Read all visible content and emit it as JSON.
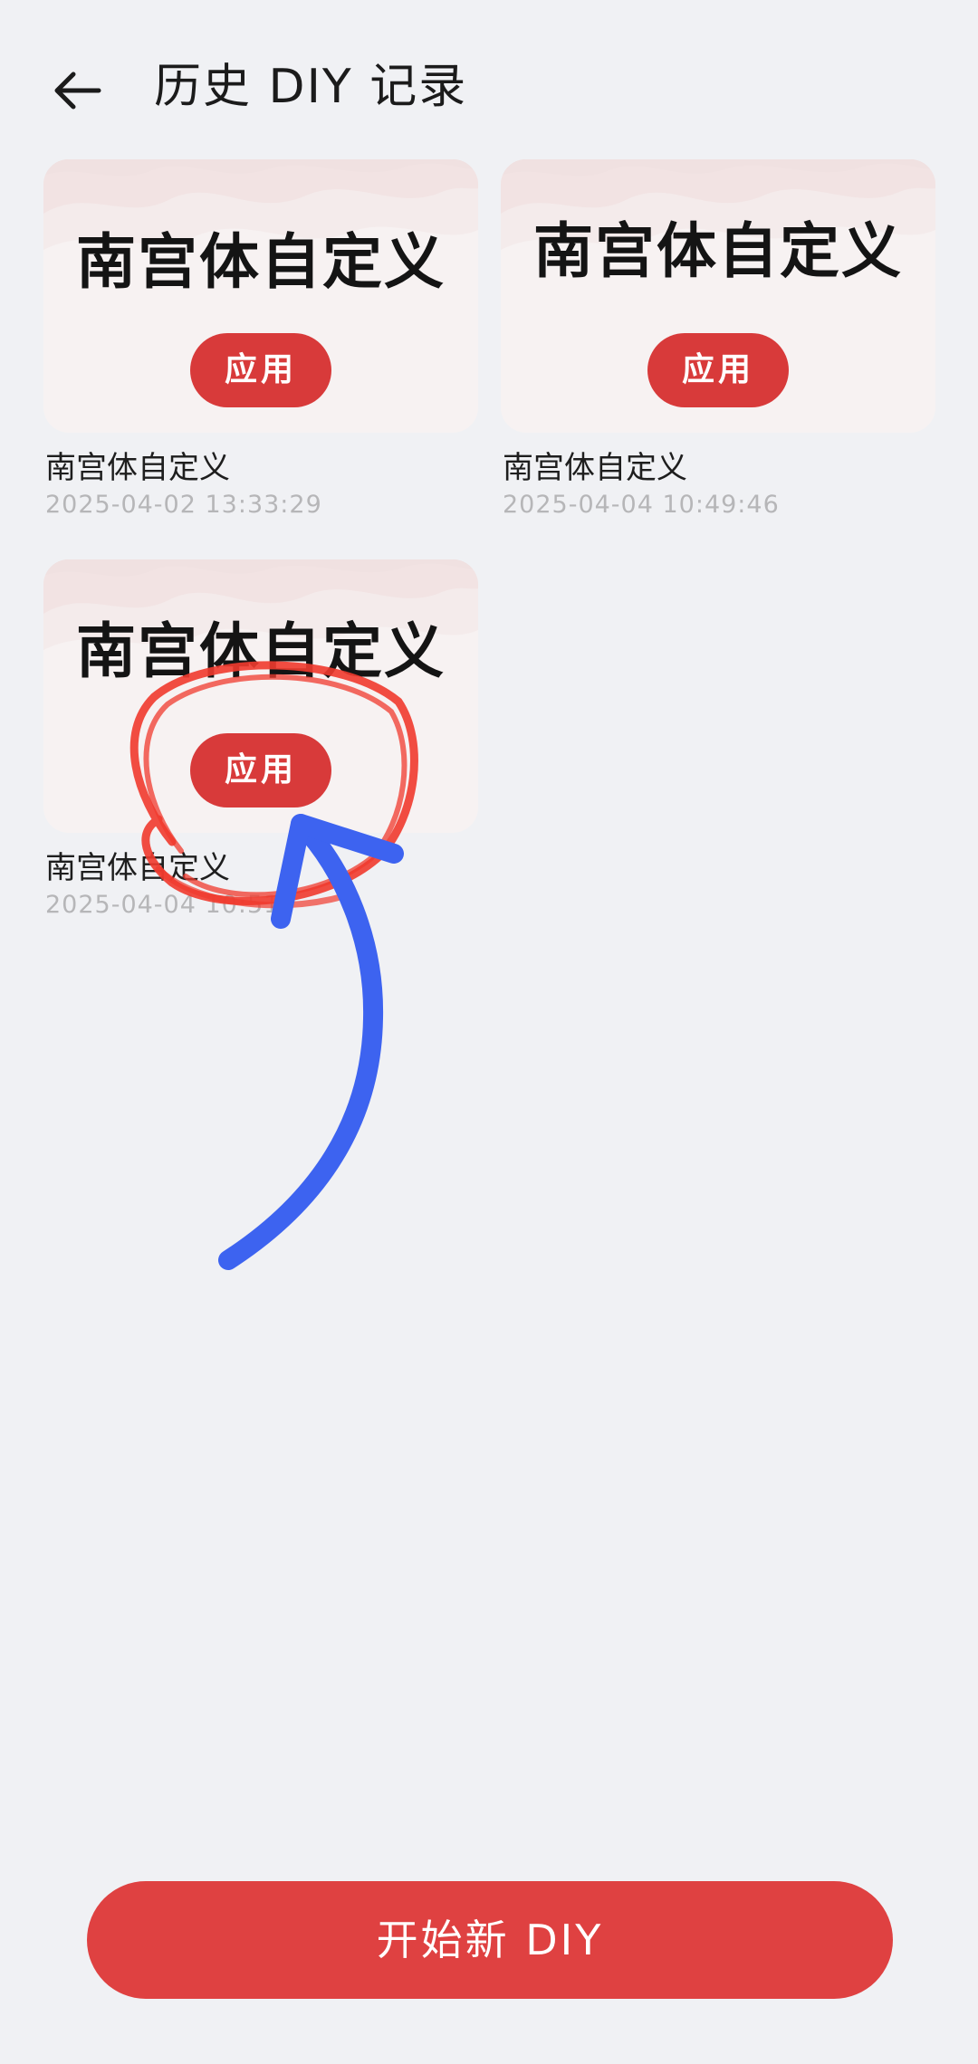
{
  "header": {
    "back_icon": "arrow-left-icon",
    "title": "历史 DIY 记录"
  },
  "records": [
    {
      "thumb_title": "南宫体自定义",
      "apply_label": "应用",
      "name": "南宫体自定义",
      "time": "2025-04-02 13:33:29"
    },
    {
      "thumb_title": "南宫体自定义",
      "apply_label": "应用",
      "name": "南宫体自定义",
      "time": "2025-04-04 10:49:46"
    },
    {
      "thumb_title": "南宫体自定义",
      "apply_label": "应用",
      "name": "南宫体自定义",
      "time": "2025-04-04 10:51:"
    }
  ],
  "footer": {
    "start_label": "开始新 DIY"
  },
  "colors": {
    "accent_red": "#d83a3a",
    "background": "#f0f1f4",
    "annotation_circle": "#f03a2e",
    "annotation_arrow": "#3d63f0"
  }
}
